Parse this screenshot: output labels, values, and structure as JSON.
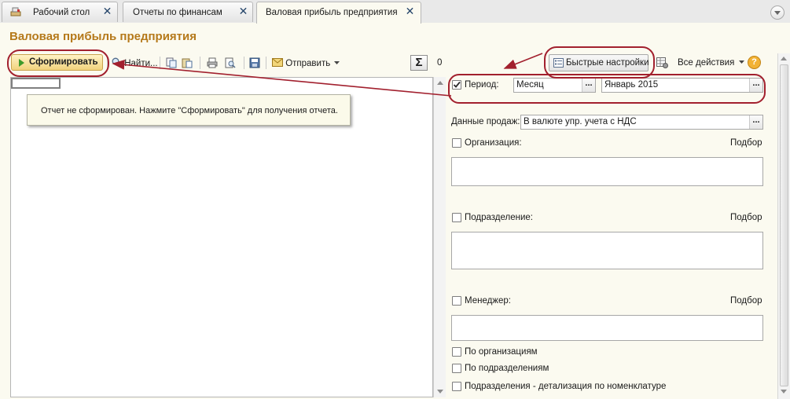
{
  "tabs": [
    {
      "label": "Рабочий стол",
      "icon": "desktop-icon"
    },
    {
      "label": "Отчеты по финансам"
    },
    {
      "label": "Валовая прибыль предприятия",
      "active": true
    }
  ],
  "page_title": "Валовая прибыль предприятия",
  "toolbar": {
    "generate_label": "Сформировать",
    "find_label": "Найти...",
    "send_label": "Отправить",
    "sum_symbol": "Σ",
    "sum_value": "0",
    "quick_settings_label": "Быстрые настройки",
    "all_actions_label": "Все действия",
    "help_symbol": "?"
  },
  "report": {
    "notice": "Отчет не сформирован. Нажмите \"Сформировать\" для получения отчета."
  },
  "settings": {
    "period": {
      "label": "Период:",
      "checked": true,
      "type_value": "Месяц",
      "value": "Январь 2015"
    },
    "sales_data": {
      "label": "Данные продаж:",
      "value": "В валюте упр. учета с НДС"
    },
    "organization": {
      "label": "Организация:",
      "pick_label": "Подбор"
    },
    "department": {
      "label": "Подразделение:",
      "pick_label": "Подбор"
    },
    "manager": {
      "label": "Менеджер:",
      "pick_label": "Подбор"
    },
    "options": [
      "По организациям",
      "По подразделениям",
      "Подразделения - детализация по номенклатуре"
    ]
  },
  "colors": {
    "title": "#b5791a",
    "annotation": "#a2202e",
    "background": "#fbfaf0"
  }
}
